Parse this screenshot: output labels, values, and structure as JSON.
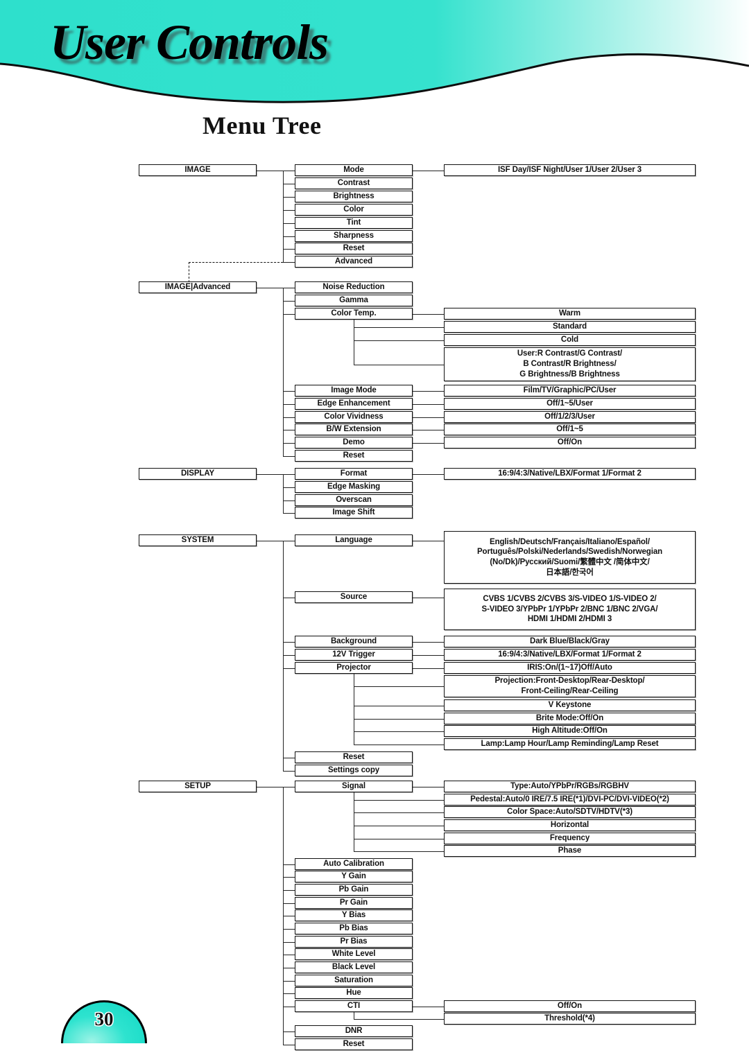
{
  "header": {
    "doc_title": "User Controls",
    "page_heading": "Menu Tree",
    "banner_color": "#2EE0CC",
    "page_number": "30"
  },
  "tree": {
    "sections": [
      {
        "id": "image",
        "root": "IMAGE",
        "items": [
          {
            "label": "Mode",
            "values": "ISF Day/ISF Night/User 1/User 2/User 3"
          },
          {
            "label": "Contrast",
            "values": null
          },
          {
            "label": "Brightness",
            "values": null
          },
          {
            "label": "Color",
            "values": null
          },
          {
            "label": "Tint",
            "values": null
          },
          {
            "label": "Sharpness",
            "values": null
          },
          {
            "label": "Reset",
            "values": null
          },
          {
            "label": "Advanced",
            "values": null
          }
        ]
      },
      {
        "id": "image-advanced",
        "root": "IMAGE|Advanced",
        "items": [
          {
            "label": "Noise Reduction",
            "values": null
          },
          {
            "label": "Gamma",
            "values": null
          },
          {
            "label": "Color Temp.",
            "values": null
          },
          {
            "label": "Image Mode",
            "values": "Film/TV/Graphic/PC/User"
          },
          {
            "label": "Edge Enhancement",
            "values": "Off/1~5/User"
          },
          {
            "label": "Color Vividness",
            "values": "Off/1/2/3/User"
          },
          {
            "label": "B/W Extension",
            "values": "Off/1~5"
          },
          {
            "label": "Demo",
            "values": "Off/On"
          },
          {
            "label": "Reset",
            "values": null
          }
        ],
        "color_temp_options": [
          {
            "lines": [
              "Warm"
            ]
          },
          {
            "lines": [
              "Standard"
            ]
          },
          {
            "lines": [
              "Cold"
            ]
          },
          {
            "lines": [
              "User:R Contrast/G Contrast/",
              "B Contrast/R Brightness/",
              "G Brightness/B Brightness"
            ]
          }
        ]
      },
      {
        "id": "display",
        "root": "DISPLAY",
        "items": [
          {
            "label": "Format",
            "values": "16:9/4:3/Native/LBX/Format 1/Format 2"
          },
          {
            "label": "Edge Masking",
            "values": null
          },
          {
            "label": "Overscan",
            "values": null
          },
          {
            "label": "Image Shift",
            "values": null
          }
        ]
      },
      {
        "id": "system",
        "root": "SYSTEM",
        "items": [
          {
            "label": "Language",
            "values": null
          },
          {
            "label": "Source",
            "values": null
          },
          {
            "label": "Background",
            "values": "Dark Blue/Black/Gray"
          },
          {
            "label": "12V Trigger",
            "values": "16:9/4:3/Native/LBX/Format 1/Format 2"
          },
          {
            "label": "Projector",
            "values": null
          },
          {
            "label": "Reset",
            "values": null
          },
          {
            "label": "Settings copy",
            "values": null
          }
        ],
        "language_options": [
          "English/Deutsch/Français/Italiano/Español/",
          "Português/Polski/Nederlands/Swedish/Norwegian",
          "(No/Dk)/Русский/Suomi/繁體中文 /简体中文/",
          "日本語/한국어"
        ],
        "source_options": [
          "CVBS 1/CVBS 2/CVBS 3/S-VIDEO 1/S-VIDEO 2/",
          "S-VIDEO 3/YPbPr 1/YPbPr 2/BNC 1/BNC 2/VGA/",
          "HDMI 1/HDMI 2/HDMI 3"
        ],
        "projector_options": [
          {
            "lines": [
              "IRIS:On/(1~17)Off/Auto"
            ]
          },
          {
            "lines": [
              "Projection:Front-Desktop/Rear-Desktop/",
              "Front-Ceiling/Rear-Ceiling"
            ]
          },
          {
            "lines": [
              "V Keystone"
            ]
          },
          {
            "lines": [
              "Brite Mode:Off/On"
            ]
          },
          {
            "lines": [
              "High Altitude:Off/On"
            ]
          },
          {
            "lines": [
              "Lamp:Lamp Hour/Lamp Reminding/Lamp Reset"
            ]
          }
        ]
      },
      {
        "id": "setup",
        "root": "SETUP",
        "items": [
          {
            "label": "Signal",
            "values": null
          },
          {
            "label": "Auto Calibration",
            "values": null
          },
          {
            "label": "Y Gain",
            "values": null
          },
          {
            "label": "Pb Gain",
            "values": null
          },
          {
            "label": "Pr Gain",
            "values": null
          },
          {
            "label": "Y Bias",
            "values": null
          },
          {
            "label": "Pb Bias",
            "values": null
          },
          {
            "label": "Pr Bias",
            "values": null
          },
          {
            "label": "White Level",
            "values": null
          },
          {
            "label": "Black Level",
            "values": null
          },
          {
            "label": "Saturation",
            "values": null
          },
          {
            "label": "Hue",
            "values": null
          },
          {
            "label": "CTI",
            "values": null
          },
          {
            "label": "DNR",
            "values": null
          },
          {
            "label": "Reset",
            "values": null
          }
        ],
        "signal_options": [
          "Type:Auto/YPbPr/RGBs/RGBHV",
          "Pedestal:Auto/0 IRE/7.5 IRE(*1)/DVI-PC/DVI-VIDEO(*2)",
          "Color Space:Auto/SDTV/HDTV(*3)",
          "Horizontal",
          "Frequency",
          "Phase"
        ],
        "cti_options": [
          "Off/On",
          "Threshold(*4)"
        ]
      }
    ]
  }
}
